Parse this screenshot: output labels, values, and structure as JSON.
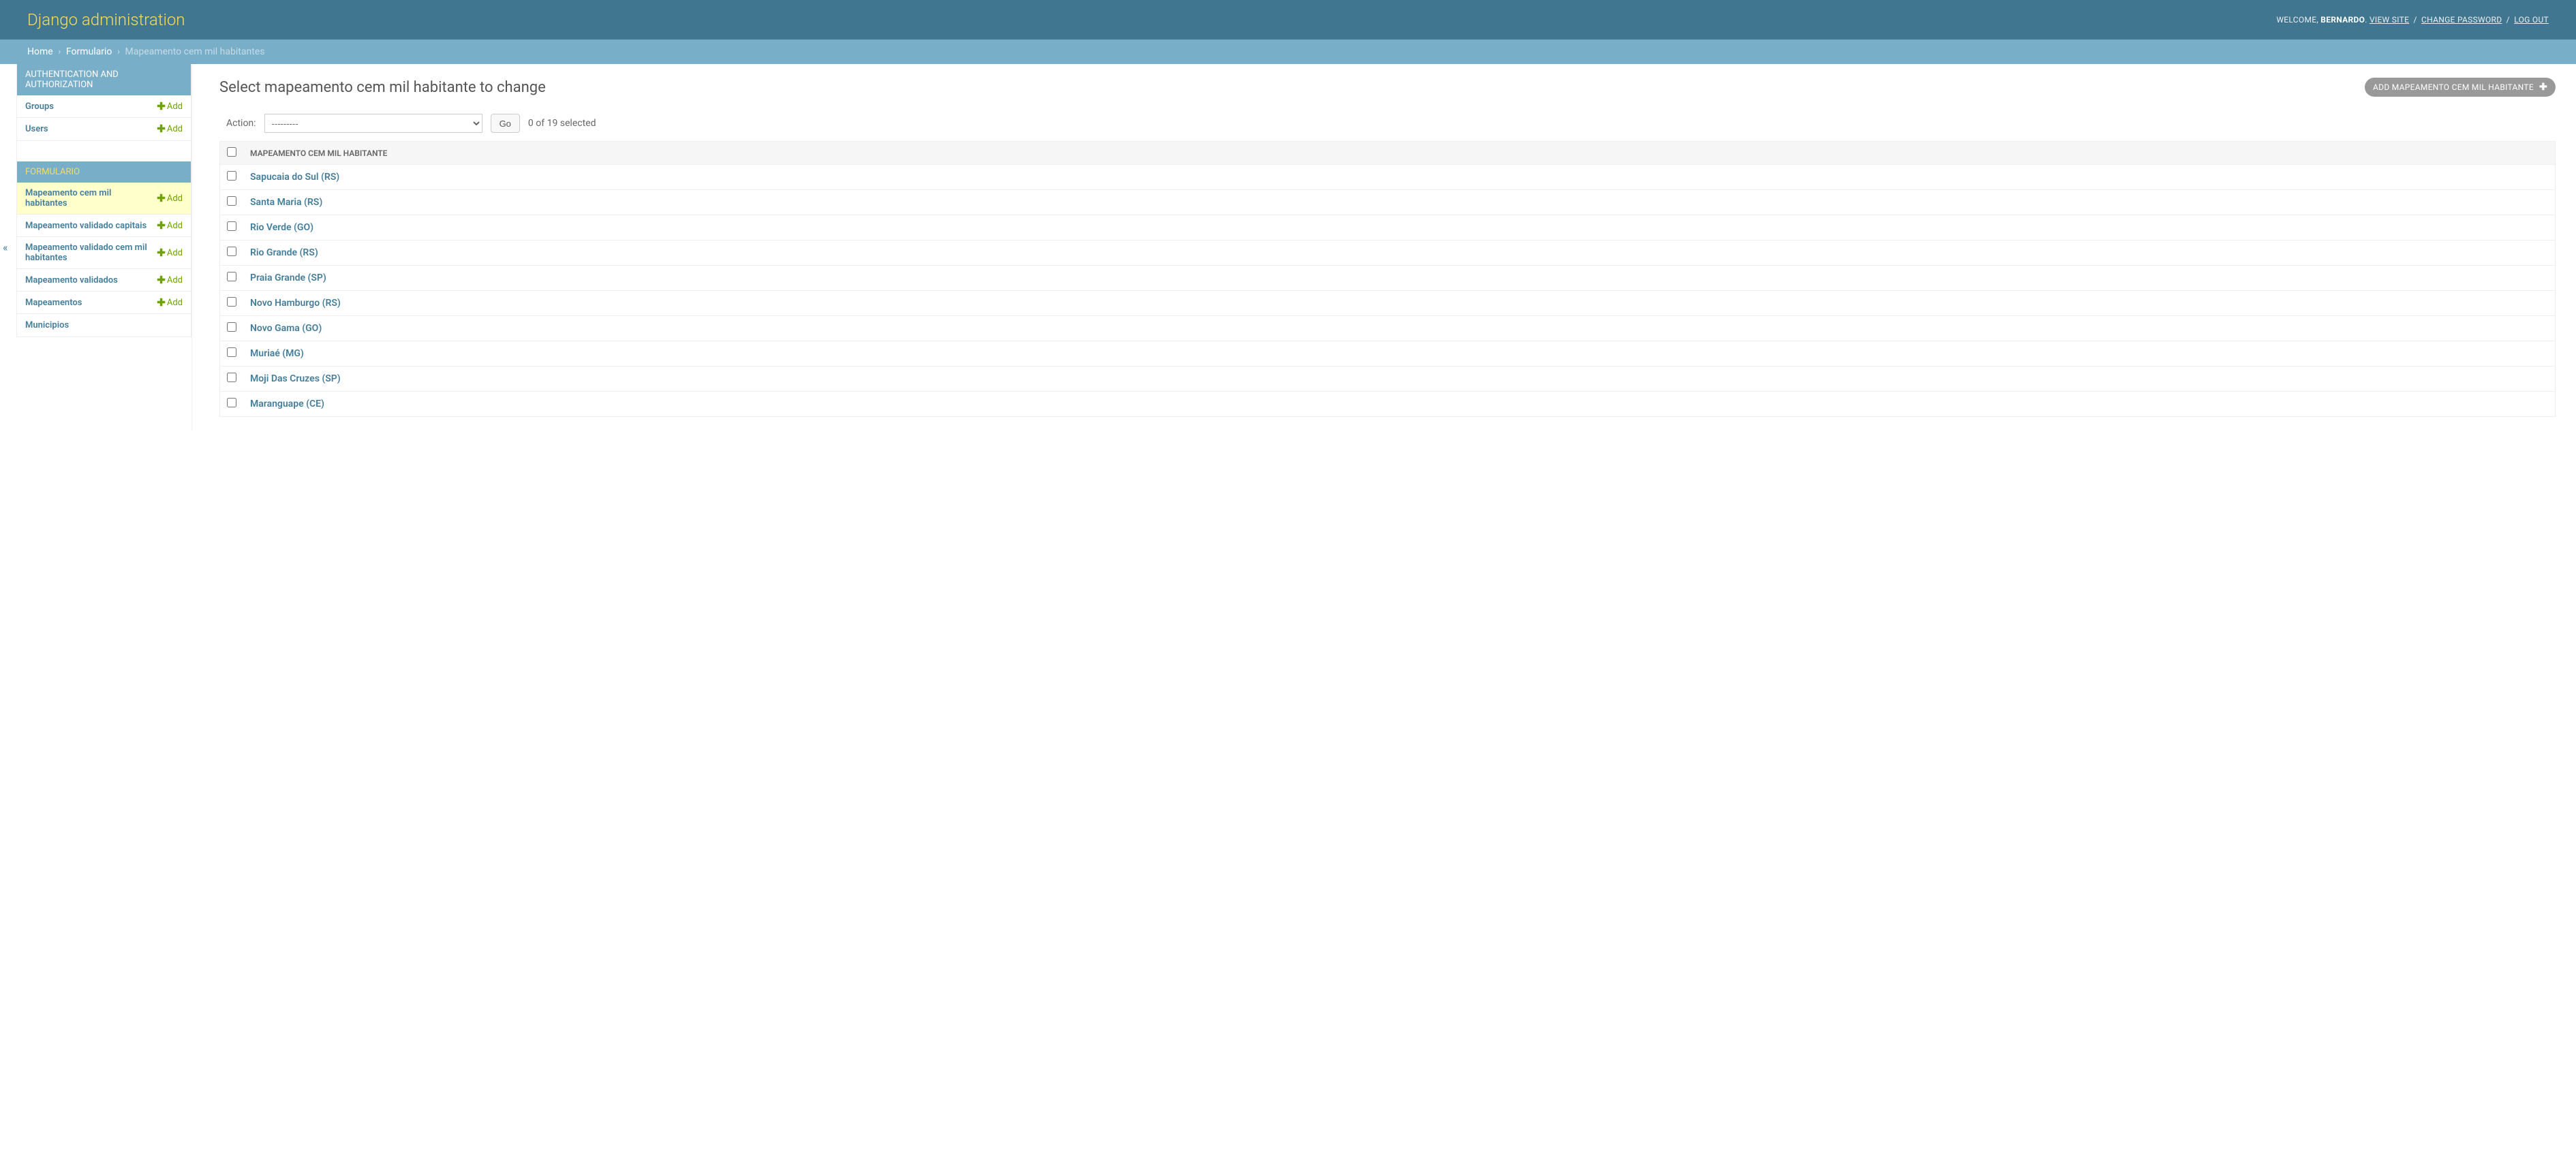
{
  "header": {
    "site_title": "Django administration",
    "welcome": "WELCOME,",
    "username": "BERNARDO",
    "view_site": "VIEW SITE",
    "change_password": "CHANGE PASSWORD",
    "log_out": "LOG OUT"
  },
  "breadcrumbs": {
    "home": "Home",
    "app": "Formulario",
    "current": "Mapeamento cem mil habitantes"
  },
  "sidebar": {
    "apps": [
      {
        "caption": "AUTHENTICATION AND AUTHORIZATION",
        "highlight": false,
        "models": [
          {
            "name": "Groups",
            "add": "Add",
            "active": false,
            "has_add": true
          },
          {
            "name": "Users",
            "add": "Add",
            "active": false,
            "has_add": true
          }
        ]
      },
      {
        "caption": "FORMULARIO",
        "highlight": true,
        "models": [
          {
            "name": "Mapeamento cem mil habitantes",
            "add": "Add",
            "active": true,
            "has_add": true
          },
          {
            "name": "Mapeamento validado capitais",
            "add": "Add",
            "active": false,
            "has_add": true
          },
          {
            "name": "Mapeamento validado cem mil habitantes",
            "add": "Add",
            "active": false,
            "has_add": true
          },
          {
            "name": "Mapeamento validados",
            "add": "Add",
            "active": false,
            "has_add": true
          },
          {
            "name": "Mapeamentos",
            "add": "Add",
            "active": false,
            "has_add": true
          },
          {
            "name": "Municipios",
            "add": "",
            "active": false,
            "has_add": false
          }
        ]
      }
    ]
  },
  "content": {
    "title": "Select mapeamento cem mil habitante to change",
    "add_button": "ADD MAPEAMENTO CEM MIL HABITANTE",
    "action_label": "Action:",
    "action_placeholder": "---------",
    "go_label": "Go",
    "selection_counter": "0 of 19 selected",
    "column_header": "MAPEAMENTO CEM MIL HABITANTE",
    "rows": [
      {
        "label": "Sapucaia do Sul (RS)"
      },
      {
        "label": "Santa Maria (RS)"
      },
      {
        "label": "Rio Verde (GO)"
      },
      {
        "label": "Rio Grande (RS)"
      },
      {
        "label": "Praia Grande (SP)"
      },
      {
        "label": "Novo Hamburgo (RS)"
      },
      {
        "label": "Novo Gama (GO)"
      },
      {
        "label": "Muriaé (MG)"
      },
      {
        "label": "Moji Das Cruzes (SP)"
      },
      {
        "label": "Maranguape (CE)"
      }
    ]
  }
}
